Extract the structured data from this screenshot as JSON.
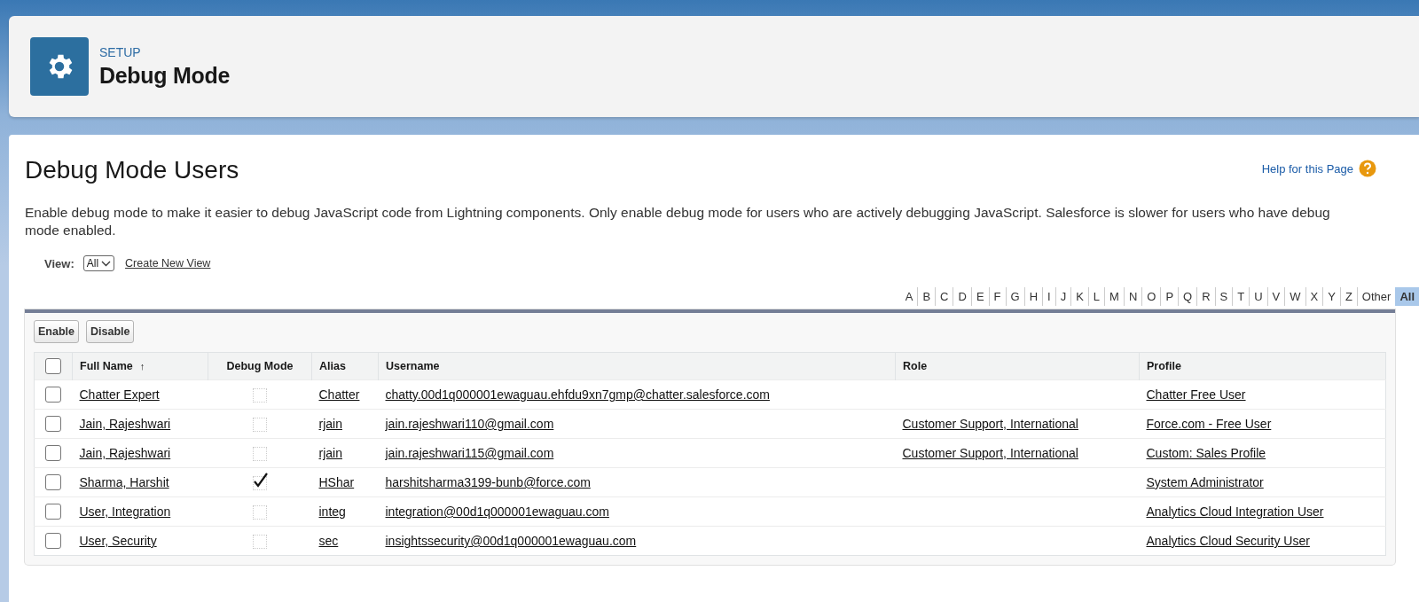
{
  "header": {
    "eyebrow": "SETUP",
    "title": "Debug Mode"
  },
  "page": {
    "title": "Debug Mode Users",
    "help_link": "Help for this Page",
    "description": "Enable debug mode to make it easier to debug JavaScript code from Lightning components. Only enable debug mode for users who are actively debugging JavaScript. Salesforce is slower for users who have debug mode enabled."
  },
  "view": {
    "label": "View:",
    "value": "All",
    "create_link": "Create New View"
  },
  "alphabet": [
    {
      "label": "A",
      "selected": false
    },
    {
      "label": "B",
      "selected": false
    },
    {
      "label": "C",
      "selected": false
    },
    {
      "label": "D",
      "selected": false
    },
    {
      "label": "E",
      "selected": false
    },
    {
      "label": "F",
      "selected": false
    },
    {
      "label": "G",
      "selected": false
    },
    {
      "label": "H",
      "selected": false
    },
    {
      "label": "I",
      "selected": false
    },
    {
      "label": "J",
      "selected": false
    },
    {
      "label": "K",
      "selected": false
    },
    {
      "label": "L",
      "selected": false
    },
    {
      "label": "M",
      "selected": false
    },
    {
      "label": "N",
      "selected": false
    },
    {
      "label": "O",
      "selected": false
    },
    {
      "label": "P",
      "selected": false
    },
    {
      "label": "Q",
      "selected": false
    },
    {
      "label": "R",
      "selected": false
    },
    {
      "label": "S",
      "selected": false
    },
    {
      "label": "T",
      "selected": false
    },
    {
      "label": "U",
      "selected": false
    },
    {
      "label": "V",
      "selected": false
    },
    {
      "label": "W",
      "selected": false
    },
    {
      "label": "X",
      "selected": false
    },
    {
      "label": "Y",
      "selected": false
    },
    {
      "label": "Z",
      "selected": false
    },
    {
      "label": "Other",
      "selected": false
    },
    {
      "label": "All",
      "selected": true
    }
  ],
  "buttons": [
    "Enable",
    "Disable"
  ],
  "table": {
    "select_all_checked": false,
    "columns": [
      "Full Name",
      "Debug Mode",
      "Alias",
      "Username",
      "Role",
      "Profile"
    ],
    "sort_indicator": "↑",
    "rows": [
      {
        "checked": false,
        "full_name": "Chatter Expert",
        "debug_mode": false,
        "alias": "Chatter",
        "username": "chatty.00d1q000001ewaguau.ehfdu9xn7gmp@chatter.salesforce.com",
        "profile": "Chatter Free User"
      },
      {
        "checked": false,
        "full_name": "Jain, Rajeshwari",
        "debug_mode": false,
        "alias": "rjain",
        "username": "jain.rajeshwari110@gmail.com",
        "role": "Customer Support, International",
        "profile": "Force.com - Free User"
      },
      {
        "checked": false,
        "full_name": "Jain, Rajeshwari",
        "debug_mode": false,
        "alias": "rjain",
        "username": "jain.rajeshwari115@gmail.com",
        "role": "Customer Support, International",
        "profile": "Custom: Sales Profile"
      },
      {
        "checked": false,
        "full_name": "Sharma, Harshit",
        "debug_mode": true,
        "alias": "HShar",
        "username": "harshitsharma3199-bunb@force.com",
        "profile": "System Administrator"
      },
      {
        "checked": false,
        "full_name": "User, Integration",
        "debug_mode": false,
        "alias": "integ",
        "username": "integration@00d1q000001ewaguau.com",
        "profile": "Analytics Cloud Integration User"
      },
      {
        "checked": false,
        "full_name": "User, Security",
        "debug_mode": false,
        "alias": "sec",
        "username": "insightssecurity@00d1q000001ewaguau.com",
        "profile": "Analytics Cloud Security User"
      }
    ]
  }
}
